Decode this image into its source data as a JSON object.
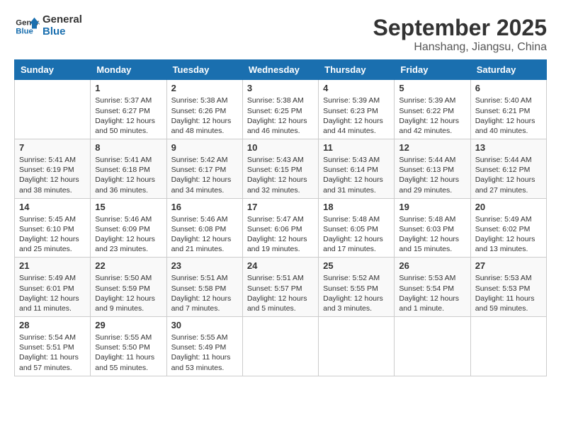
{
  "logo": {
    "line1": "General",
    "line2": "Blue"
  },
  "title": "September 2025",
  "subtitle": "Hanshang, Jiangsu, China",
  "weekdays": [
    "Sunday",
    "Monday",
    "Tuesday",
    "Wednesday",
    "Thursday",
    "Friday",
    "Saturday"
  ],
  "weeks": [
    [
      {
        "day": "",
        "info": ""
      },
      {
        "day": "1",
        "info": "Sunrise: 5:37 AM\nSunset: 6:27 PM\nDaylight: 12 hours\nand 50 minutes."
      },
      {
        "day": "2",
        "info": "Sunrise: 5:38 AM\nSunset: 6:26 PM\nDaylight: 12 hours\nand 48 minutes."
      },
      {
        "day": "3",
        "info": "Sunrise: 5:38 AM\nSunset: 6:25 PM\nDaylight: 12 hours\nand 46 minutes."
      },
      {
        "day": "4",
        "info": "Sunrise: 5:39 AM\nSunset: 6:23 PM\nDaylight: 12 hours\nand 44 minutes."
      },
      {
        "day": "5",
        "info": "Sunrise: 5:39 AM\nSunset: 6:22 PM\nDaylight: 12 hours\nand 42 minutes."
      },
      {
        "day": "6",
        "info": "Sunrise: 5:40 AM\nSunset: 6:21 PM\nDaylight: 12 hours\nand 40 minutes."
      }
    ],
    [
      {
        "day": "7",
        "info": "Sunrise: 5:41 AM\nSunset: 6:19 PM\nDaylight: 12 hours\nand 38 minutes."
      },
      {
        "day": "8",
        "info": "Sunrise: 5:41 AM\nSunset: 6:18 PM\nDaylight: 12 hours\nand 36 minutes."
      },
      {
        "day": "9",
        "info": "Sunrise: 5:42 AM\nSunset: 6:17 PM\nDaylight: 12 hours\nand 34 minutes."
      },
      {
        "day": "10",
        "info": "Sunrise: 5:43 AM\nSunset: 6:15 PM\nDaylight: 12 hours\nand 32 minutes."
      },
      {
        "day": "11",
        "info": "Sunrise: 5:43 AM\nSunset: 6:14 PM\nDaylight: 12 hours\nand 31 minutes."
      },
      {
        "day": "12",
        "info": "Sunrise: 5:44 AM\nSunset: 6:13 PM\nDaylight: 12 hours\nand 29 minutes."
      },
      {
        "day": "13",
        "info": "Sunrise: 5:44 AM\nSunset: 6:12 PM\nDaylight: 12 hours\nand 27 minutes."
      }
    ],
    [
      {
        "day": "14",
        "info": "Sunrise: 5:45 AM\nSunset: 6:10 PM\nDaylight: 12 hours\nand 25 minutes."
      },
      {
        "day": "15",
        "info": "Sunrise: 5:46 AM\nSunset: 6:09 PM\nDaylight: 12 hours\nand 23 minutes."
      },
      {
        "day": "16",
        "info": "Sunrise: 5:46 AM\nSunset: 6:08 PM\nDaylight: 12 hours\nand 21 minutes."
      },
      {
        "day": "17",
        "info": "Sunrise: 5:47 AM\nSunset: 6:06 PM\nDaylight: 12 hours\nand 19 minutes."
      },
      {
        "day": "18",
        "info": "Sunrise: 5:48 AM\nSunset: 6:05 PM\nDaylight: 12 hours\nand 17 minutes."
      },
      {
        "day": "19",
        "info": "Sunrise: 5:48 AM\nSunset: 6:03 PM\nDaylight: 12 hours\nand 15 minutes."
      },
      {
        "day": "20",
        "info": "Sunrise: 5:49 AM\nSunset: 6:02 PM\nDaylight: 12 hours\nand 13 minutes."
      }
    ],
    [
      {
        "day": "21",
        "info": "Sunrise: 5:49 AM\nSunset: 6:01 PM\nDaylight: 12 hours\nand 11 minutes."
      },
      {
        "day": "22",
        "info": "Sunrise: 5:50 AM\nSunset: 5:59 PM\nDaylight: 12 hours\nand 9 minutes."
      },
      {
        "day": "23",
        "info": "Sunrise: 5:51 AM\nSunset: 5:58 PM\nDaylight: 12 hours\nand 7 minutes."
      },
      {
        "day": "24",
        "info": "Sunrise: 5:51 AM\nSunset: 5:57 PM\nDaylight: 12 hours\nand 5 minutes."
      },
      {
        "day": "25",
        "info": "Sunrise: 5:52 AM\nSunset: 5:55 PM\nDaylight: 12 hours\nand 3 minutes."
      },
      {
        "day": "26",
        "info": "Sunrise: 5:53 AM\nSunset: 5:54 PM\nDaylight: 12 hours\nand 1 minute."
      },
      {
        "day": "27",
        "info": "Sunrise: 5:53 AM\nSunset: 5:53 PM\nDaylight: 11 hours\nand 59 minutes."
      }
    ],
    [
      {
        "day": "28",
        "info": "Sunrise: 5:54 AM\nSunset: 5:51 PM\nDaylight: 11 hours\nand 57 minutes."
      },
      {
        "day": "29",
        "info": "Sunrise: 5:55 AM\nSunset: 5:50 PM\nDaylight: 11 hours\nand 55 minutes."
      },
      {
        "day": "30",
        "info": "Sunrise: 5:55 AM\nSunset: 5:49 PM\nDaylight: 11 hours\nand 53 minutes."
      },
      {
        "day": "",
        "info": ""
      },
      {
        "day": "",
        "info": ""
      },
      {
        "day": "",
        "info": ""
      },
      {
        "day": "",
        "info": ""
      }
    ]
  ]
}
